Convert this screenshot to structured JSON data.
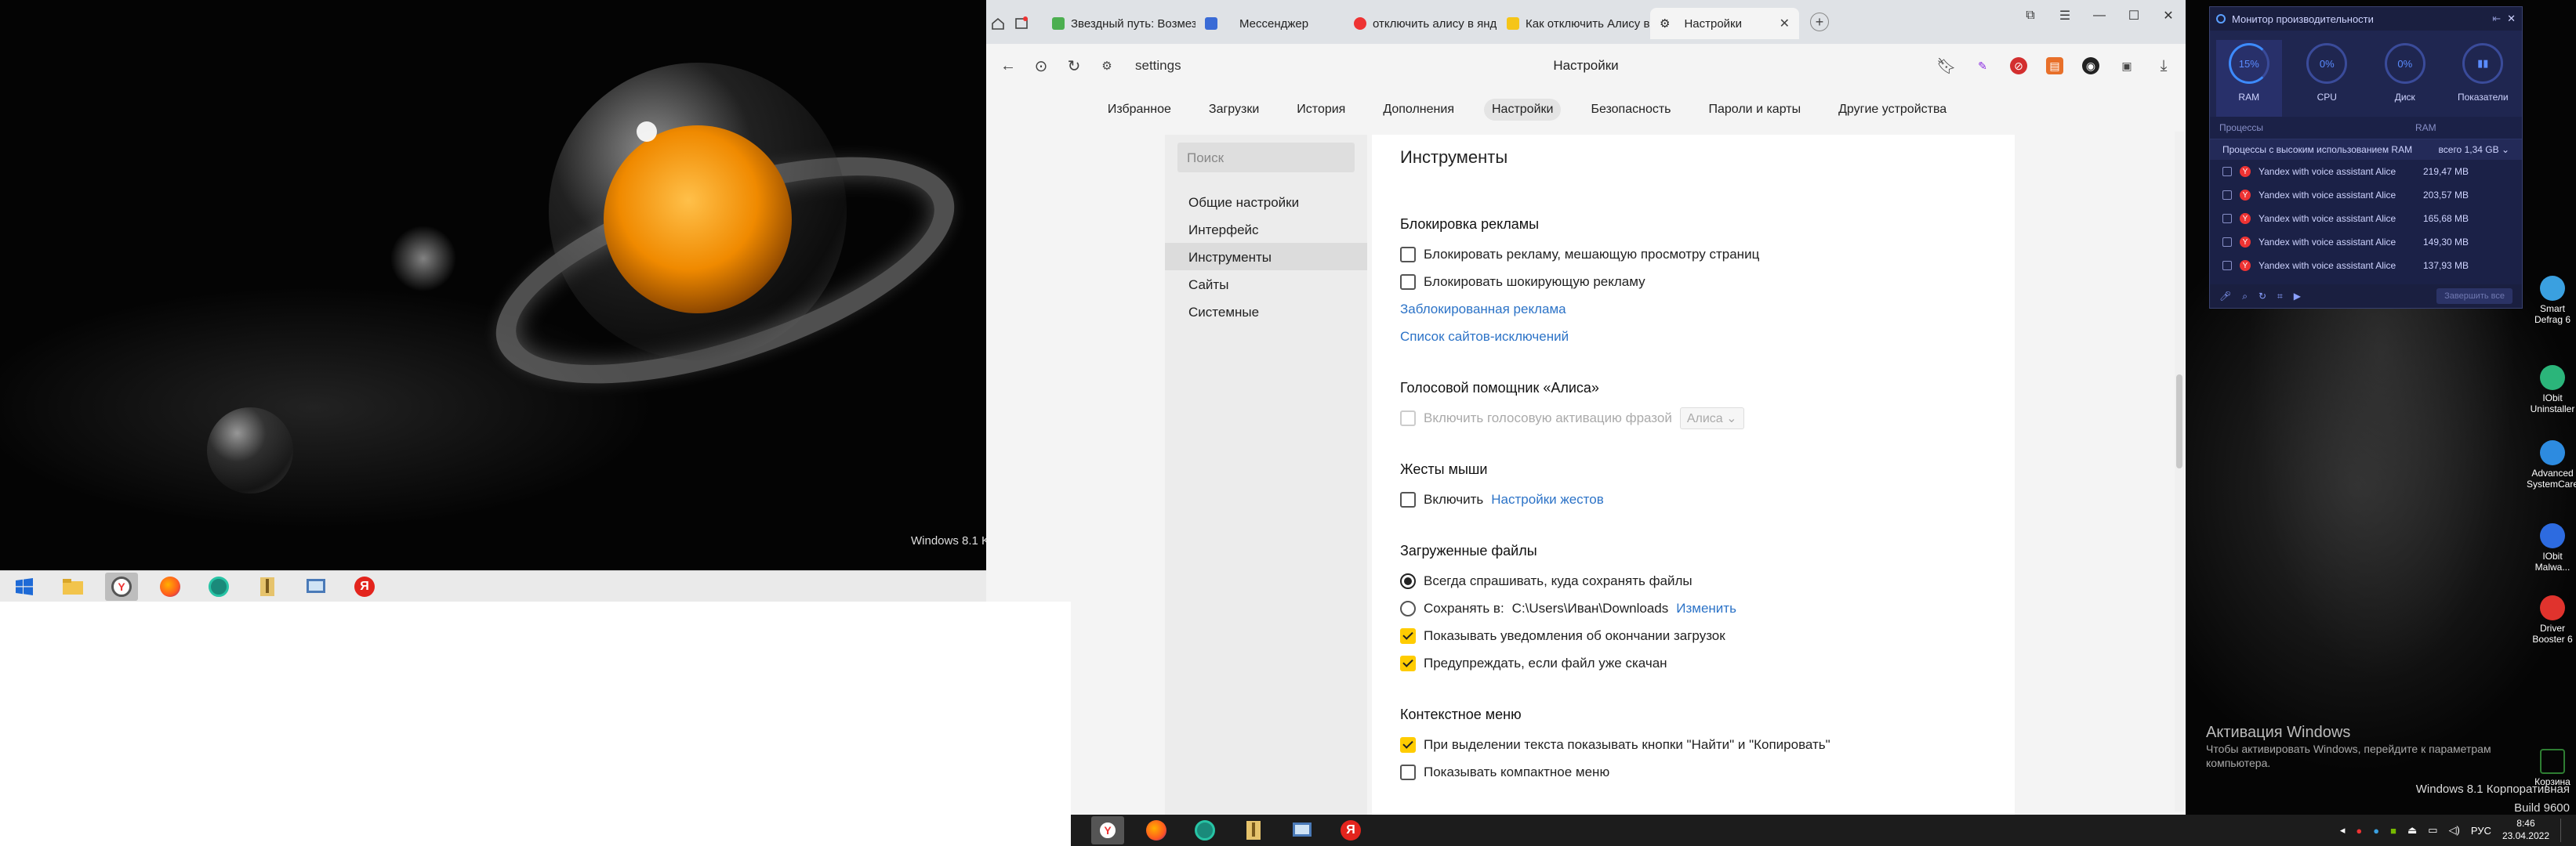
{
  "left_monitor": {
    "watermark": "Windows 8.1 K"
  },
  "browser": {
    "tabs": [
      {
        "label": "Звездный путь: Возмездие",
        "color": "#4caf50"
      },
      {
        "label": "Мессенджер",
        "color": "#3a6bd6"
      },
      {
        "label": "отключить алису в яндекс",
        "color": "#e33"
      },
      {
        "label": "Как отключить Алису в Я",
        "color": "#f5c518"
      },
      {
        "label": "Настройки",
        "color": "#666"
      }
    ],
    "address": "settings",
    "page_title": "Настройки",
    "nav": [
      "Избранное",
      "Загрузки",
      "История",
      "Дополнения",
      "Настройки",
      "Безопасность",
      "Пароли и карты",
      "Другие устройства"
    ],
    "sidebar": {
      "search_placeholder": "Поиск",
      "items": [
        "Общие настройки",
        "Интерфейс",
        "Инструменты",
        "Сайты",
        "Системные"
      ]
    },
    "content": {
      "title": "Инструменты",
      "ads": {
        "heading": "Блокировка рекламы",
        "opt1": "Блокировать рекламу, мешающую просмотру страниц",
        "opt2": "Блокировать шокирующую рекламу",
        "link1": "Заблокированная реклама",
        "link2": "Список сайтов-исключений"
      },
      "alice": {
        "heading": "Голосовой помощник «Алиса»",
        "opt1": "Включить голосовую активацию фразой",
        "select": "Алиса"
      },
      "gestures": {
        "heading": "Жесты мыши",
        "opt1": "Включить",
        "link": "Настройки жестов"
      },
      "downloads": {
        "heading": "Загруженные файлы",
        "opt1": "Всегда спрашивать, куда сохранять файлы",
        "opt2_label": "Сохранять в:",
        "opt2_path": "C:\\Users\\Иван\\Downloads",
        "opt2_link": "Изменить",
        "opt3": "Показывать уведомления об окончании загрузок",
        "opt4": "Предупреждать, если файл уже скачан"
      },
      "context": {
        "heading": "Контекстное меню",
        "opt1": "При выделении текста показывать кнопки \"Найти\" и \"Копировать\"",
        "opt2": "Показывать компактное меню"
      }
    }
  },
  "perf_monitor": {
    "title": "Монитор производительности",
    "tiles": [
      {
        "value": "15%",
        "label": "RAM"
      },
      {
        "value": "0%",
        "label": "CPU"
      },
      {
        "value": "0%",
        "label": "Диск"
      },
      {
        "value": "",
        "label": "Показатели"
      }
    ],
    "col_process": "Процессы",
    "col_ram": "RAM",
    "filter_label": "Процессы с высоким использованием RAM",
    "filter_total": "всего 1,34 GB",
    "processes": [
      {
        "name": "Yandex with voice assistant Alice",
        "ram": "219,47 MB"
      },
      {
        "name": "Yandex with voice assistant Alice",
        "ram": "203,57 MB"
      },
      {
        "name": "Yandex with voice assistant Alice",
        "ram": "165,68 MB"
      },
      {
        "name": "Yandex with voice assistant Alice",
        "ram": "149,30 MB"
      },
      {
        "name": "Yandex with voice assistant Alice",
        "ram": "137,93 MB"
      }
    ],
    "stop_label": "Завершить все"
  },
  "desktop_icons": [
    {
      "label": "Smart Defrag 6",
      "color": "#3aa0e0"
    },
    {
      "label": "IObit Uninstaller",
      "color": "#2bb57a"
    },
    {
      "label": "Advanced SystemCare",
      "color": "#2d8be0"
    },
    {
      "label": "IObit Malwa...",
      "color": "#2d6be0"
    },
    {
      "label": "Driver Booster 6",
      "color": "#e0332d"
    },
    {
      "label": "Корзина",
      "color": "#2e7d32"
    }
  ],
  "activation": {
    "title": "Активация Windows",
    "subtitle": "Чтобы активировать Windows, перейдите к параметрам компьютера."
  },
  "winver": {
    "line1": "Windows 8.1 Корпоративная",
    "line2": "Build 9600"
  },
  "tray": {
    "lang": "РУС",
    "time": "8:46",
    "date": "23.04.2022"
  }
}
